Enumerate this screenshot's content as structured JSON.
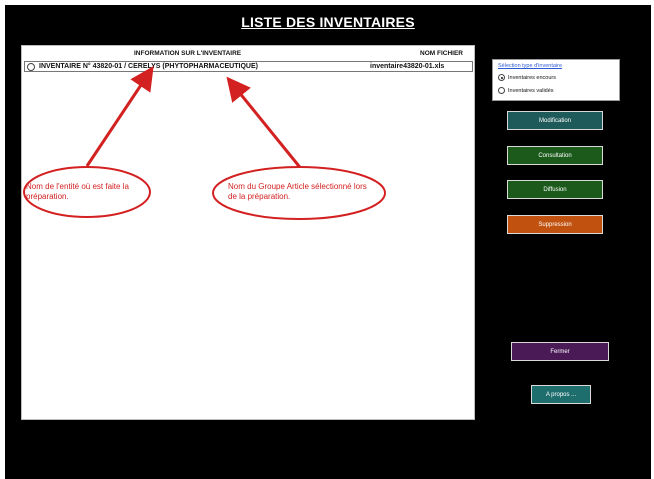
{
  "page": {
    "title": "LISTE DES INVENTAIRES"
  },
  "table": {
    "columns": {
      "info": "INFORMATION SUR L'INVENTAIRE",
      "file": "NOM FICHIER"
    },
    "rows": [
      {
        "selected": false,
        "info": "INVENTAIRE N° 43820-01 / CERELYS (PHYTOPHARMACEUTIQUE)",
        "file": "inventaire43820-01.xls"
      }
    ]
  },
  "annotations": {
    "left": "Nom de l'entité où est faite la préparation.",
    "right": "Nom du Groupe Article sélectionné lors de la préparation.",
    "color": "#d32020"
  },
  "filter": {
    "title": "Sélection type d'inventaire",
    "options": [
      {
        "label": "Inventaires encours",
        "checked": true
      },
      {
        "label": "Inventaires validés",
        "checked": false
      }
    ]
  },
  "buttons": {
    "modification": {
      "label": "Modification",
      "color": "#1f5a5a"
    },
    "consultation": {
      "label": "Consultation",
      "color": "#1c5a1c"
    },
    "diffusion": {
      "label": "Diffusion",
      "color": "#1c5a1c"
    },
    "suppression": {
      "label": "Suppression",
      "color": "#c0510e"
    },
    "fermer": {
      "label": "Fermer",
      "color": "#4a1a57"
    },
    "apropos": {
      "label": "A propos ...",
      "color": "#1f6e6e"
    }
  }
}
